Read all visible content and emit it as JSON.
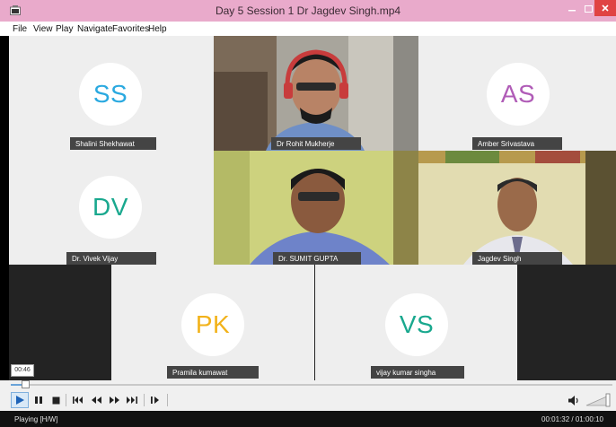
{
  "window": {
    "title": "Day 5 Session 1 Dr Jagdev Singh.mp4"
  },
  "menu": [
    "File",
    "View",
    "Play",
    "Navigate",
    "Favorites",
    "Help"
  ],
  "participants": [
    {
      "name": "Shalini Shekhawat",
      "initials": "SS",
      "color": "#2aa9e0"
    },
    {
      "name": "Dr Rohit Mukherje"
    },
    {
      "name": "Amber Srivastava",
      "initials": "AS",
      "color": "#b05cb7"
    },
    {
      "name": "Dr. Vivek Vijay",
      "initials": "DV",
      "color": "#19a88e"
    },
    {
      "name": "Dr. SUMIT GUPTA"
    },
    {
      "name": "Jagdev Singh"
    },
    {
      "name": "Pramila kumawat",
      "initials": "PK",
      "color": "#f2b21a"
    },
    {
      "name": "vijay kumar singha",
      "initials": "VS",
      "color": "#19a88e"
    }
  ],
  "overlay": {
    "timestamp": "00:46"
  },
  "player": {
    "progress": 0.02,
    "status": "Playing [H/W]",
    "time": "00:01:32 / 01:00:10"
  },
  "colors": {
    "title_bar": "#e9aacb",
    "close_button": "#e04343",
    "status_bar": "#111111"
  }
}
